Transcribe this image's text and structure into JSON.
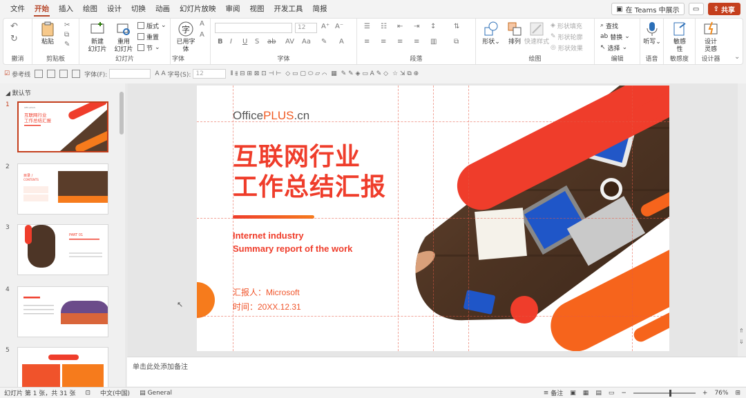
{
  "menu": {
    "tabs": [
      "文件",
      "开始",
      "插入",
      "绘图",
      "设计",
      "切换",
      "动画",
      "幻灯片放映",
      "审阅",
      "视图",
      "开发工具",
      "简报"
    ],
    "active_tab": "开始",
    "teams_label": "在 Teams 中展示",
    "share_label": "共享"
  },
  "ribbon": {
    "groups": {
      "undo": "撤消",
      "clipboard": "剪贴板",
      "slides": "幻灯片",
      "font": "字体",
      "paragraph": "段落",
      "drawing": "绘图",
      "editing": "编辑",
      "voice": "语音",
      "sensitivity": "敏感度",
      "designer": "设计器"
    },
    "buttons": {
      "paste": "粘贴",
      "new_slide": "新建\n幻灯片",
      "reuse_slide": "重用\n幻灯片",
      "layout": "版式",
      "reset": "重置",
      "section": "节",
      "used_font": "已用字\n体",
      "font_size": "12",
      "shape": "形状",
      "arrange": "排列",
      "quick_style": "快速样式",
      "shape_fill": "形状填充",
      "shape_outline": "形状轮廓",
      "shape_effect": "形状效果",
      "find": "查找",
      "replace": "替换",
      "select": "选择",
      "dictate": "听写",
      "sensitivity": "敏感\n性",
      "design_ideas": "设计\n灵感"
    }
  },
  "toolbar2": {
    "guides": "参考线",
    "font_name": "字体(F):",
    "font_size": "字号(S):",
    "font_size_value": "12"
  },
  "thumbs": {
    "section": "默认节",
    "numbers": [
      "1",
      "2",
      "3",
      "4",
      "5"
    ]
  },
  "slide": {
    "logo_a": "Office",
    "logo_b": "PLUS",
    "logo_c": ".cn",
    "title_line1": "互联网行业",
    "title_line2": "工作总结汇报",
    "en_line1": "Internet industry",
    "en_line2": "Summary report of the work",
    "reporter": "汇报人：Microsoft",
    "date": "时间：20XX.12.31"
  },
  "notes_placeholder": "单击此处添加备注",
  "status": {
    "slide_count": "幻灯片 第 1 张，共 31 张",
    "language": "中文(中国)",
    "sensitivity": "General",
    "notes": "备注",
    "zoom": "76%"
  },
  "colors": {
    "accent": "#c43e1c",
    "slide_red": "#ef3d2b",
    "slide_orange": "#f67b1c"
  }
}
